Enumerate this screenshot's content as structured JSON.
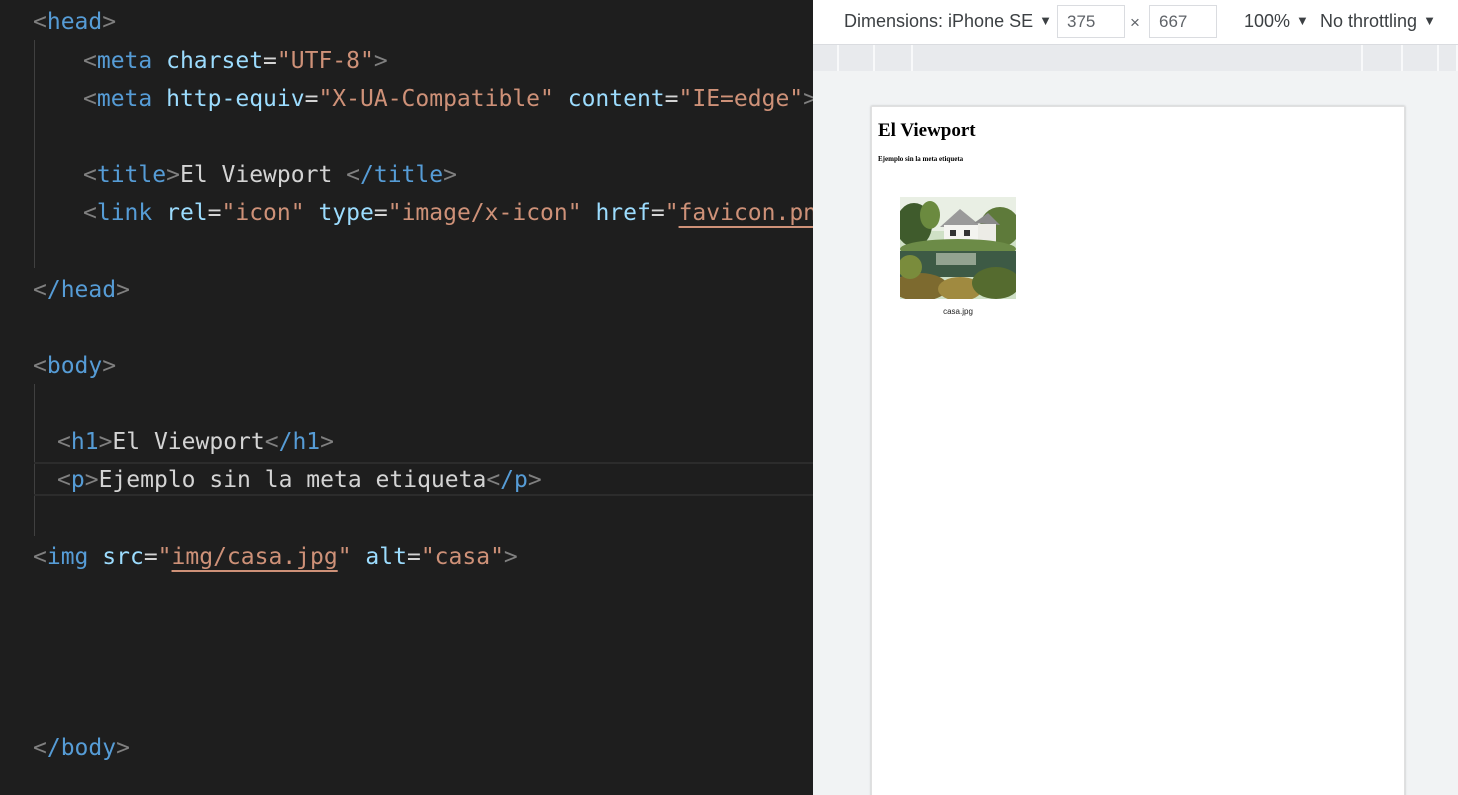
{
  "editor": {
    "lines": {
      "head_open": {
        "tag": "head"
      },
      "meta_charset": {
        "tag": "meta",
        "attr": "charset",
        "value": "\"UTF-8\""
      },
      "meta_compat": {
        "tag": "meta",
        "attr1": "http-equiv",
        "value1": "\"X-UA-Compatible\"",
        "attr2": "content",
        "value2": "\"IE=edge\""
      },
      "title": {
        "tag": "title",
        "text": "El Viewport ",
        "close_tag": "/title"
      },
      "link": {
        "tag": "link",
        "attr1": "rel",
        "value1": "\"icon\"",
        "attr2": "type",
        "value2": "\"image/x-icon\"",
        "attr3": "href",
        "value3_quote_open": "\"",
        "value3_link": "favicon.png",
        "value3_quote_close": "\""
      },
      "head_close": {
        "tag": "/head"
      },
      "body_open": {
        "tag": "body"
      },
      "h1": {
        "tag": "h1",
        "text": "El Viewport",
        "close_tag": "/h1"
      },
      "p": {
        "tag": "p",
        "text": "Ejemplo sin la meta etiqueta",
        "close_tag": "/p"
      },
      "img": {
        "tag": "img",
        "attr1": "src",
        "value1_quote_open": "\"",
        "value1_link": "img/casa.jpg",
        "value1_quote_close": "\"",
        "attr2": "alt",
        "value2": "\"casa\""
      },
      "body_close": {
        "tag": "/body"
      }
    }
  },
  "devtools": {
    "device_label": "Dimensions: iPhone SE",
    "width_value": "375",
    "height_value": "667",
    "dimension_separator": "×",
    "zoom_label": "100%",
    "throttling_label": "No throttling",
    "dropdown_glyph": "▼"
  },
  "preview": {
    "heading": "El Viewport",
    "paragraph": "Ejemplo sin la meta etiqueta",
    "image_caption": "casa.jpg"
  },
  "colors": {
    "editor_bg": "#1e1e1e",
    "tag_name": "#569cd6",
    "attr_name": "#9cdcfe",
    "attr_value": "#ce9178",
    "bracket": "#808080",
    "text": "#d4d4d4"
  }
}
